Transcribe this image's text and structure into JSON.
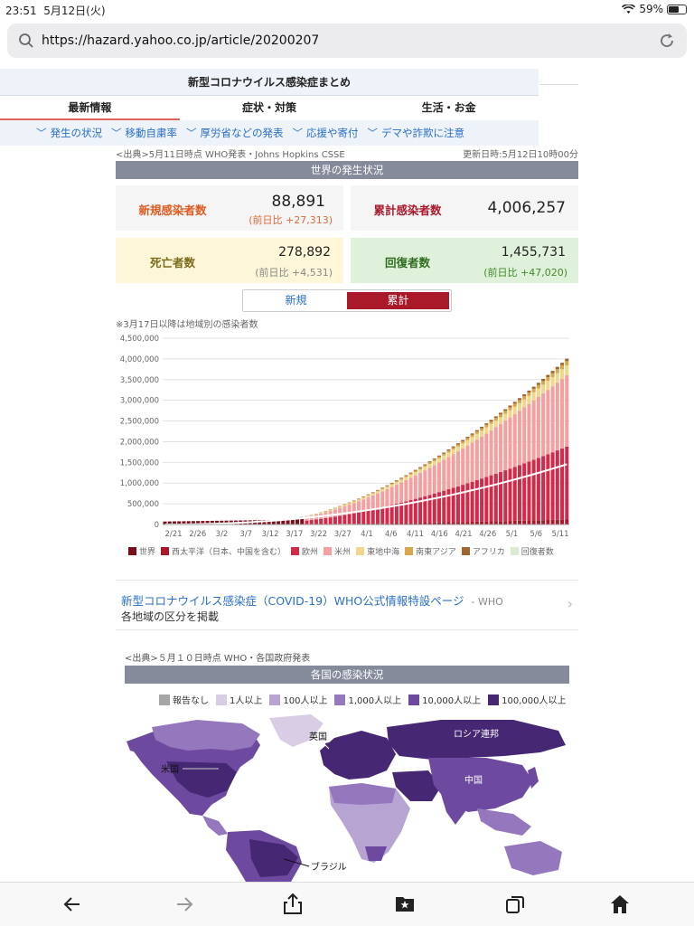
{
  "status": {
    "time": "23:51",
    "date": "5月12日(火)",
    "battery": "59%",
    "battery_level": 0.59
  },
  "browser": {
    "url": "https://hazard.yahoo.co.jp/article/20200207"
  },
  "nav": {
    "title": "新型コロナウイルス感染症まとめ",
    "tabs": [
      {
        "label": "最新情報"
      },
      {
        "label": "症状・対策"
      },
      {
        "label": "生活・お金"
      }
    ],
    "subnav": [
      {
        "label": "発生の状況"
      },
      {
        "label": "移動自粛率"
      },
      {
        "label": "厚労省などの発表"
      },
      {
        "label": "応援や寄付"
      },
      {
        "label": "デマや詐欺に注意"
      }
    ]
  },
  "world": {
    "source": "<出典>5月11日時点 WHO発表・Johns Hopkins CSSE",
    "updated": "更新日時:5月12日10時00分",
    "section_title": "世界の発生状況",
    "new_label": "新規感染者数",
    "new_value": "88,891",
    "new_diff": "(前日比 +27,313)",
    "total_label": "累計感染者数",
    "total_value": "4,006,257",
    "death_label": "死亡者数",
    "death_value": "278,892",
    "death_diff": "(前日比 +4,531)",
    "recover_label": "回復者数",
    "recover_value": "1,455,731",
    "recover_diff": "(前日比 +47,020)",
    "toggle_new": "新規",
    "toggle_total": "累計",
    "note": "※3月17日以降は地域別の感染者数"
  },
  "chart_data": {
    "type": "bar",
    "stacked": true,
    "ylim": [
      0,
      4500000
    ],
    "yticks": [
      "4,500,000",
      "4,000,000",
      "3,500,000",
      "3,000,000",
      "2,500,000",
      "2,000,000",
      "1,500,000",
      "1,000,000",
      "500,000",
      "0"
    ],
    "xticks": [
      "2/21",
      "2/26",
      "3/2",
      "3/7",
      "3/12",
      "3/17",
      "3/22",
      "3/27",
      "4/1",
      "4/6",
      "4/11",
      "4/16",
      "4/21",
      "4/26",
      "5/1",
      "5/6",
      "5/11"
    ],
    "legend": [
      "世界",
      "西太平洋（日本、中国を含む）",
      "欧州",
      "米州",
      "東地中海",
      "南東アジア",
      "アフリカ",
      "回復者数"
    ],
    "colors": {
      "world": "#7a0f1c",
      "wpac": "#a9192a",
      "europe": "#d42a4a",
      "americas": "#f4a0a0",
      "emed": "#f0d78c",
      "seasia": "#d9a64a",
      "africa": "#a0642e",
      "recovered": "#d9ecd1"
    },
    "end_values": {
      "total": 4006257,
      "europe_top": 1880000,
      "americas_top": 3600000,
      "emed_top": 3850000,
      "recovered": 1455731
    },
    "grid": true
  },
  "links": {
    "who_title": "新型コロナウイルス感染症（COVID-19）WHO公式情報特設ページ",
    "who_src": "- WHO",
    "who_desc": "各地域の区分を掲載"
  },
  "map": {
    "source": "<出典>５月１０日時点 WHO・各国政府発表",
    "section_title": "各国の感染状況",
    "legend": [
      {
        "label": "報告なし",
        "color": "#a6a6a6"
      },
      {
        "label": "1人以上",
        "color": "#d9cde6"
      },
      {
        "label": "100人以上",
        "color": "#b8a4d3"
      },
      {
        "label": "1,000人以上",
        "color": "#9577bd"
      },
      {
        "label": "10,000人以上",
        "color": "#6d4aa0"
      },
      {
        "label": "100,000人以上",
        "color": "#452773"
      }
    ],
    "labels": {
      "uk": "英国",
      "russia": "ロシア連邦",
      "usa": "米国",
      "china": "中国",
      "brazil": "ブラジル"
    }
  }
}
